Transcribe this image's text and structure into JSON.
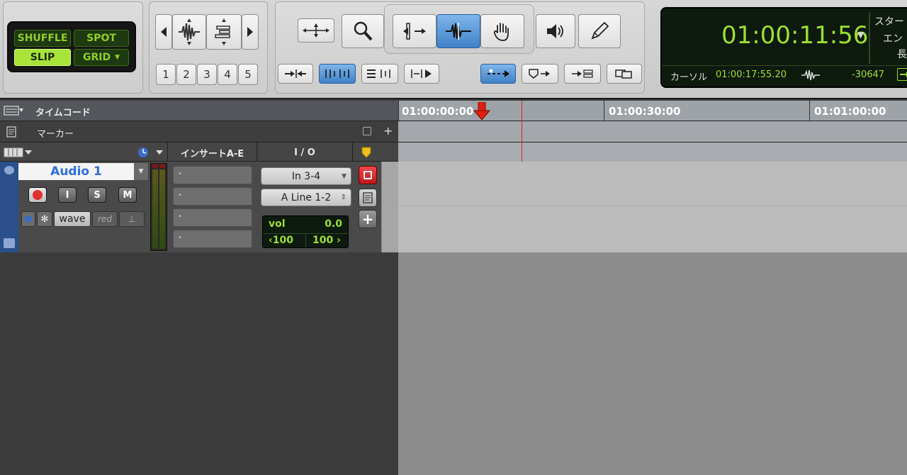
{
  "modes": {
    "shuffle": "SHUFFLE",
    "spot": "SPOT",
    "slip": "SLIP",
    "grid": "GRID"
  },
  "zoom_presets": [
    "1",
    "2",
    "3",
    "4",
    "5"
  ],
  "counter": {
    "main_time": "01:00:11:56",
    "cursor_label": "カーソル",
    "cursor_time": "01:00:17:55.20",
    "sample_value": "-30647",
    "side_labels": [
      "スター",
      "エン",
      "長"
    ]
  },
  "timeline": {
    "ruler_label": "タイムコード",
    "marker_label": "マーカー",
    "ticks": [
      "01:00:00:00",
      "01:00:30:00",
      "01:01:00:00"
    ]
  },
  "track_header": {
    "inserts_label": "インサートA-E",
    "io_label": "I / O"
  },
  "track": {
    "name": "Audio 1",
    "rec": "●",
    "input_monitor": "I",
    "solo": "S",
    "mute": "M",
    "view": "wave",
    "color": "red",
    "input": "In 3-4",
    "output": "A Line 1-2",
    "vol_label": "vol",
    "vol_value": "0.0",
    "pan_left": "‹100",
    "pan_right": "100 ›"
  },
  "colors": {
    "lcd_green": "#9be030",
    "playhead": "#e02010",
    "track_name": "#2f6fe0"
  }
}
